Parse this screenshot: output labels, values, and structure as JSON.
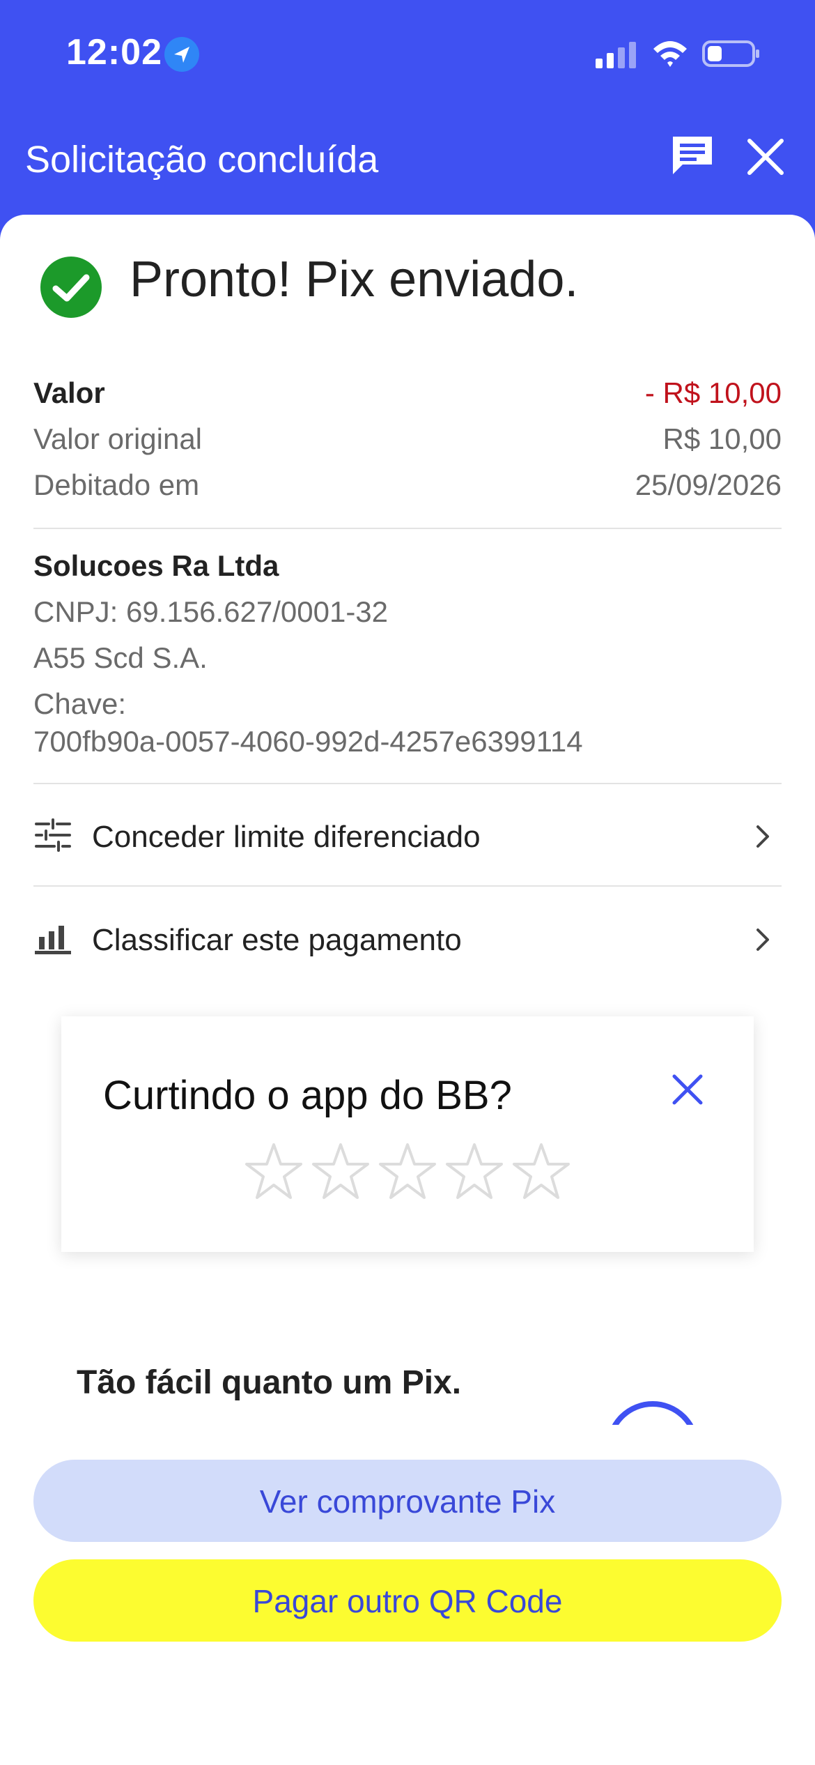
{
  "status_bar": {
    "time": "12:02",
    "icons": [
      "location-arrow-icon",
      "signal-icon",
      "wifi-icon",
      "battery-icon"
    ]
  },
  "header": {
    "title": "Solicitação concluída",
    "icons": [
      "chat-icon",
      "close-icon"
    ]
  },
  "confirmation": {
    "message": "Pronto! Pix enviado.",
    "icon": "check-circle-icon"
  },
  "details": {
    "valor_label": "Valor",
    "valor_value": "- R$ 10,00",
    "original_label": "Valor original",
    "original_value": "R$ 10,00",
    "debit_label": "Debitado em",
    "debit_value": "25/09/2026"
  },
  "payee": {
    "name": "Solucoes Ra Ltda",
    "cnpj": "CNPJ: 69.156.627/0001-32",
    "institution": "A55 Scd S.A.",
    "key_label": "Chave:",
    "key_value": "700fb90a-0057-4060-992d-4257e6399114"
  },
  "actions": [
    {
      "label": "Conceder limite diferenciado",
      "icon": "sliders-icon"
    },
    {
      "label": "Classificar este pagamento",
      "icon": "bar-chart-icon"
    }
  ],
  "rating": {
    "title": "Curtindo o app do BB?",
    "stars": 5,
    "selected": 0
  },
  "promo": {
    "text": "Tão fácil quanto um Pix."
  },
  "buttons": {
    "receipt": "Ver comprovante Pix",
    "pay_other": "Pagar outro QR Code"
  },
  "colors": {
    "brand_blue": "#3f51f2",
    "negative_red": "#c0121c",
    "success_green": "#1c9a2a",
    "button_light": "#d2dcfa",
    "button_yellow": "#fcfc30"
  }
}
